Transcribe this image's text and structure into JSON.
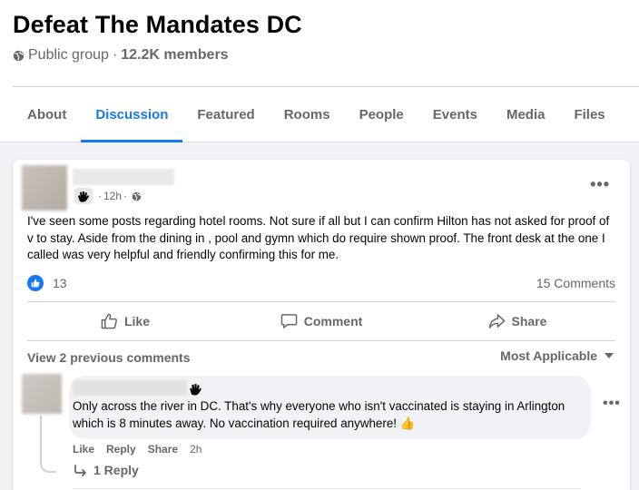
{
  "group": {
    "title": "Defeat The Mandates DC",
    "privacy": "Public group",
    "separator": "·",
    "members": "12.2K members"
  },
  "tabs": [
    {
      "label": "About",
      "active": false
    },
    {
      "label": "Discussion",
      "active": true
    },
    {
      "label": "Featured",
      "active": false
    },
    {
      "label": "Rooms",
      "active": false
    },
    {
      "label": "People",
      "active": false
    },
    {
      "label": "Events",
      "active": false
    },
    {
      "label": "Media",
      "active": false
    },
    {
      "label": "Files",
      "active": false
    }
  ],
  "post": {
    "time": "12h",
    "dot": "·",
    "menu": "•••",
    "body": "I've seen some posts regarding hotel rooms.  Not sure if all but I can confirm Hilton has not asked for proof of v to stay.  Aside from the dining in , pool and gymn which do require shown proof. The front desk at the one I called was very helpful and friendly confirming this for me.",
    "reaction_count": "13",
    "comments_count": "15 Comments",
    "actions": {
      "like": "Like",
      "comment": "Comment",
      "share": "Share"
    }
  },
  "comments": {
    "view_previous": "View 2 previous comments",
    "sort": "Most Applicable",
    "items": [
      {
        "text": "Only across the river in DC. That's why everyone who isn't vaccinated is staying in Arlington which is 8 minutes away. No vaccination required anywhere! 👍",
        "actions": {
          "like": "Like",
          "reply": "Reply",
          "share": "Share"
        },
        "time": "2h",
        "replies": "1 Reply",
        "menu": "•••"
      }
    ]
  },
  "colors": {
    "accent": "#1877f2",
    "secondary_text": "#65676b",
    "page_bg": "#f0f2f5"
  }
}
